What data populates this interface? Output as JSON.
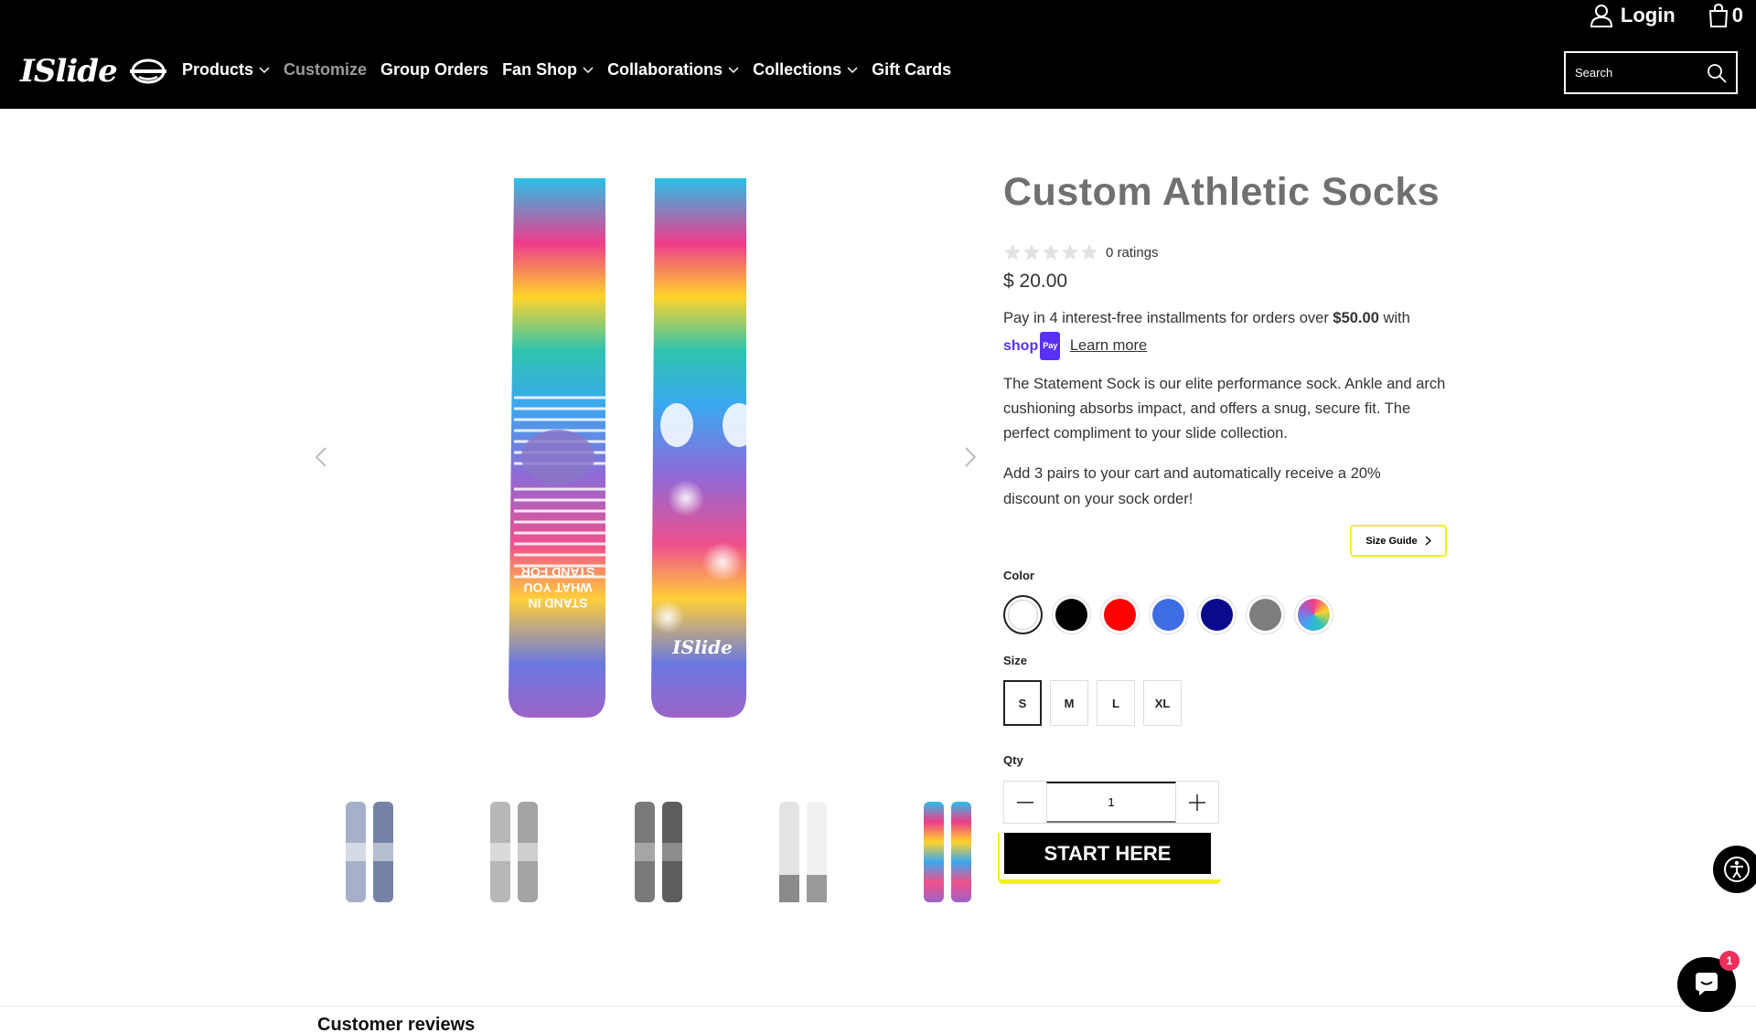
{
  "brand": {
    "logo_text": "ISlide"
  },
  "nav": {
    "items": [
      {
        "label": "Products",
        "dropdown": true,
        "muted": false
      },
      {
        "label": "Customize",
        "dropdown": false,
        "muted": true
      },
      {
        "label": "Group Orders",
        "dropdown": false,
        "muted": false
      },
      {
        "label": "Fan Shop",
        "dropdown": true,
        "muted": false
      },
      {
        "label": "Collaborations",
        "dropdown": true,
        "muted": false
      },
      {
        "label": "Collections",
        "dropdown": true,
        "muted": false
      },
      {
        "label": "Gift Cards",
        "dropdown": false,
        "muted": false
      }
    ]
  },
  "header": {
    "login_label": "Login",
    "cart_count": "0",
    "search_placeholder": "Search"
  },
  "product": {
    "title": "Custom Athletic Socks",
    "ratings_text": "0 ratings",
    "rating_value": 0,
    "rating_max": 5,
    "price": "$ 20.00",
    "installments_pre": "Pay in 4 interest-free installments for orders over ",
    "installments_amount": "$50.00",
    "installments_post": " with",
    "shoppay_word": "shop",
    "shoppay_badge": "Pay",
    "learn_more": "Learn more",
    "description": "The Statement Sock is our elite performance sock. Ankle and arch cushioning absorbs impact, and offers a snug, secure fit. The perfect compliment to your slide collection.",
    "promo": "Add 3 pairs to your cart and automatically receive a 20% discount on your sock order!",
    "size_guide_label": "Size Guide",
    "color_label": "Color",
    "size_label": "Size",
    "qty_label": "Qty",
    "qty_value": "1",
    "cta_label": "START HERE",
    "sock_print_text": "STAND IN WHAT YOU STAND FOR",
    "colors": [
      {
        "name": "white",
        "hex": "#ffffff",
        "selected": true
      },
      {
        "name": "black",
        "hex": "#000000",
        "selected": false
      },
      {
        "name": "red",
        "hex": "#ff0000",
        "selected": false
      },
      {
        "name": "blue",
        "hex": "#3e6de3",
        "selected": false
      },
      {
        "name": "navy",
        "hex": "#0a0a8c",
        "selected": false
      },
      {
        "name": "gray",
        "hex": "#7d7d7d",
        "selected": false
      },
      {
        "name": "tie-dye",
        "hex": "multicolor",
        "selected": false
      }
    ],
    "sizes": [
      {
        "label": "S",
        "selected": true
      },
      {
        "label": "M",
        "selected": false
      },
      {
        "label": "L",
        "selected": false
      },
      {
        "label": "XL",
        "selected": false
      }
    ],
    "thumbnails": [
      "heather-navy",
      "light-gray",
      "charcoal",
      "white-gray",
      "tie-dye"
    ]
  },
  "reviews": {
    "title": "Customer reviews"
  },
  "widgets": {
    "chat_badge": "1"
  },
  "colors": {
    "header_bg": "#000000",
    "highlight": "#f3ef1f",
    "shoppay": "#5a31f4"
  }
}
